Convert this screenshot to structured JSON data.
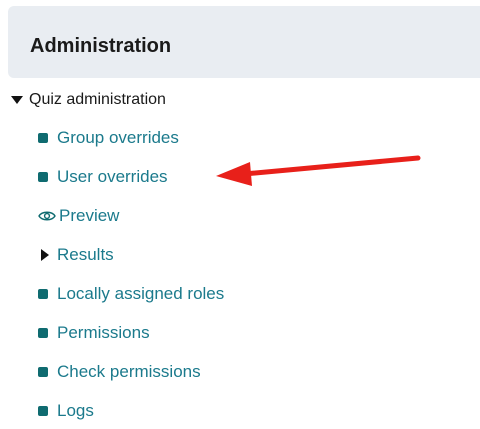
{
  "block": {
    "title": "Administration"
  },
  "tree": {
    "root_label": "Quiz administration",
    "items": [
      {
        "label": "Group overrides",
        "icon": "square-icon"
      },
      {
        "label": "User overrides",
        "icon": "square-icon"
      },
      {
        "label": "Preview",
        "icon": "eye-icon"
      },
      {
        "label": "Results",
        "icon": "caret-right-icon"
      },
      {
        "label": "Locally assigned roles",
        "icon": "square-icon"
      },
      {
        "label": "Permissions",
        "icon": "square-icon"
      },
      {
        "label": "Check permissions",
        "icon": "square-icon"
      },
      {
        "label": "Logs",
        "icon": "square-icon"
      }
    ]
  },
  "colors": {
    "link": "#1b7a8c",
    "icon": "#0f6b70",
    "header_bg": "#e9edf2",
    "annotation_arrow": "#e8201a"
  }
}
